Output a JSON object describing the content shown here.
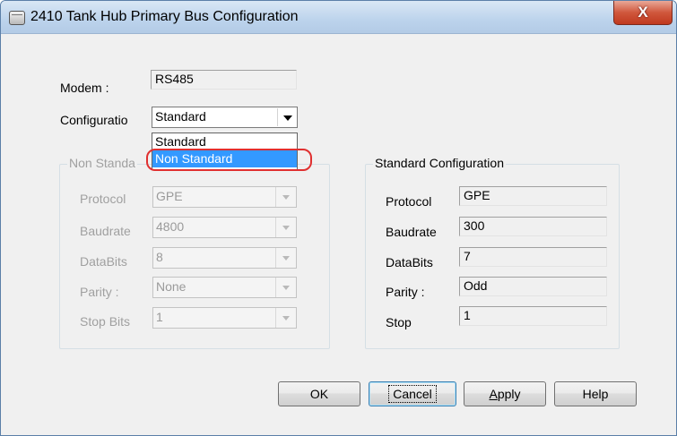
{
  "window": {
    "title": "2410 Tank Hub Primary Bus Configuration",
    "close_label": "X",
    "icon": "tank-icon"
  },
  "modem": {
    "label": "Modem :",
    "value": "RS485"
  },
  "configuration": {
    "label": "Configuratio",
    "value": "Standard",
    "options": [
      "Standard",
      "Non Standard"
    ],
    "highlighted_option": "Non Standard"
  },
  "non_standard": {
    "caption": "Non Standa",
    "protocol": {
      "label": "Protocol",
      "value": "GPE"
    },
    "baudrate": {
      "label": "Baudrate",
      "value": "4800"
    },
    "databits": {
      "label": "DataBits",
      "value": "8"
    },
    "parity": {
      "label": "Parity :",
      "value": "None"
    },
    "stopbits": {
      "label": "Stop Bits",
      "value": "1"
    }
  },
  "standard": {
    "caption": "Standard Configuration",
    "protocol": {
      "label": "Protocol",
      "value": "GPE"
    },
    "baudrate": {
      "label": "Baudrate",
      "value": "300"
    },
    "databits": {
      "label": "DataBits",
      "value": "7"
    },
    "parity": {
      "label": "Parity :",
      "value": "Odd"
    },
    "stop": {
      "label": "Stop",
      "value": "1"
    }
  },
  "buttons": {
    "ok": "OK",
    "cancel": "Cancel",
    "apply_first": "A",
    "apply_rest": "pply",
    "help": "Help"
  },
  "colors": {
    "selection": "#3399ff",
    "annotation": "#e03030",
    "close_button": "#c0391f"
  }
}
